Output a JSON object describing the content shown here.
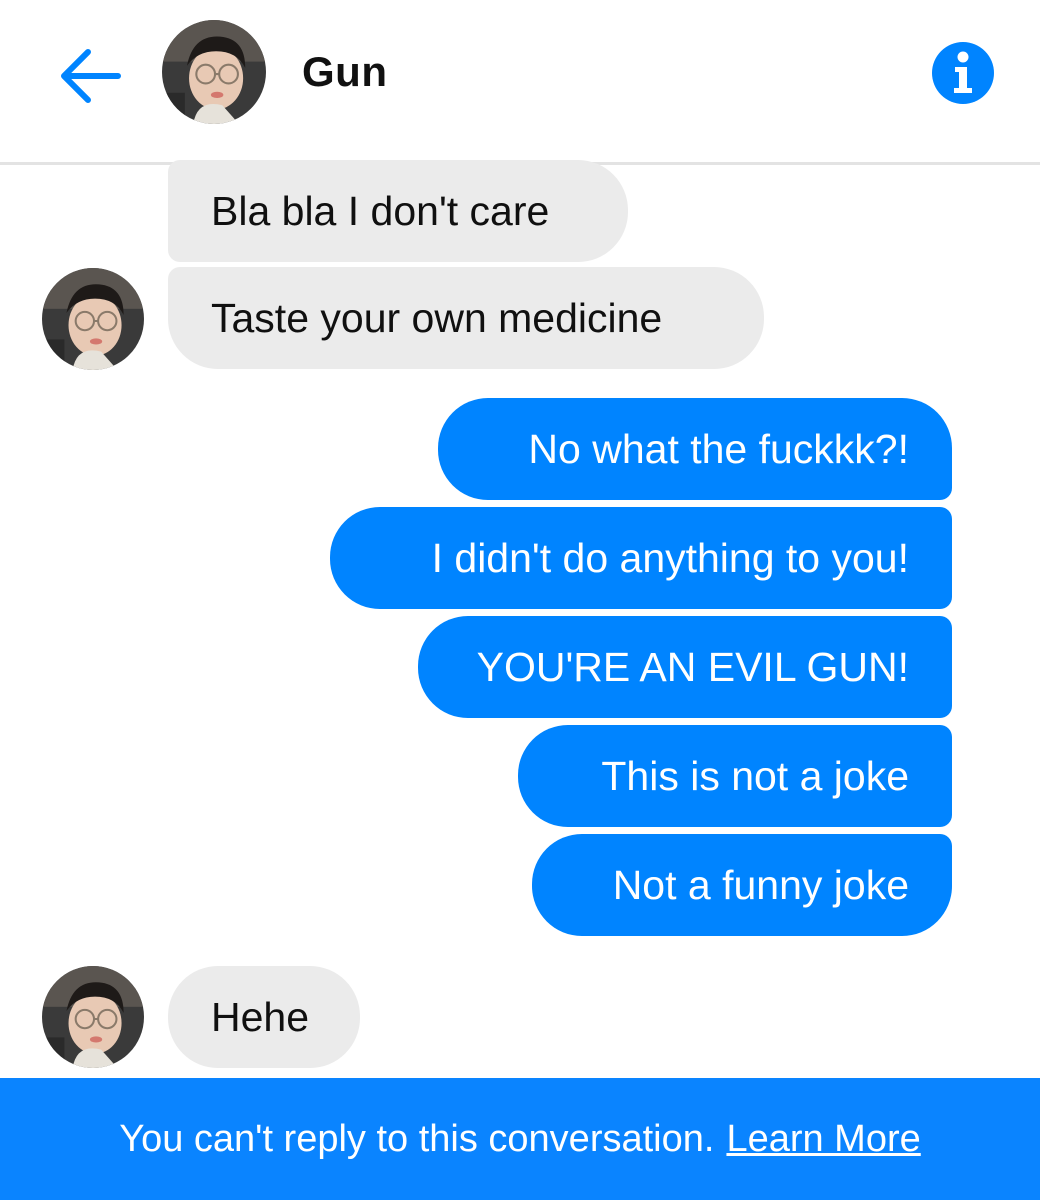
{
  "header": {
    "back_icon": "arrow-left-icon",
    "contact_name": "Gun",
    "info_icon": "info-icon",
    "accent_color": "#0084ff"
  },
  "messages": [
    {
      "sender": "contact",
      "text": "Bla bla I don't care"
    },
    {
      "sender": "contact",
      "text": "Taste your own medicine"
    },
    {
      "sender": "me",
      "text": "No what the fuckkk?!"
    },
    {
      "sender": "me",
      "text": "I didn't do anything to you!"
    },
    {
      "sender": "me",
      "text": "YOU'RE AN EVIL GUN!"
    },
    {
      "sender": "me",
      "text": "This is not a joke"
    },
    {
      "sender": "me",
      "text": "Not a funny joke"
    },
    {
      "sender": "contact",
      "text": "Hehe"
    }
  ],
  "footer": {
    "notice": "You can't reply to this conversation.",
    "link_label": "Learn More",
    "background": "#0a84ff"
  }
}
